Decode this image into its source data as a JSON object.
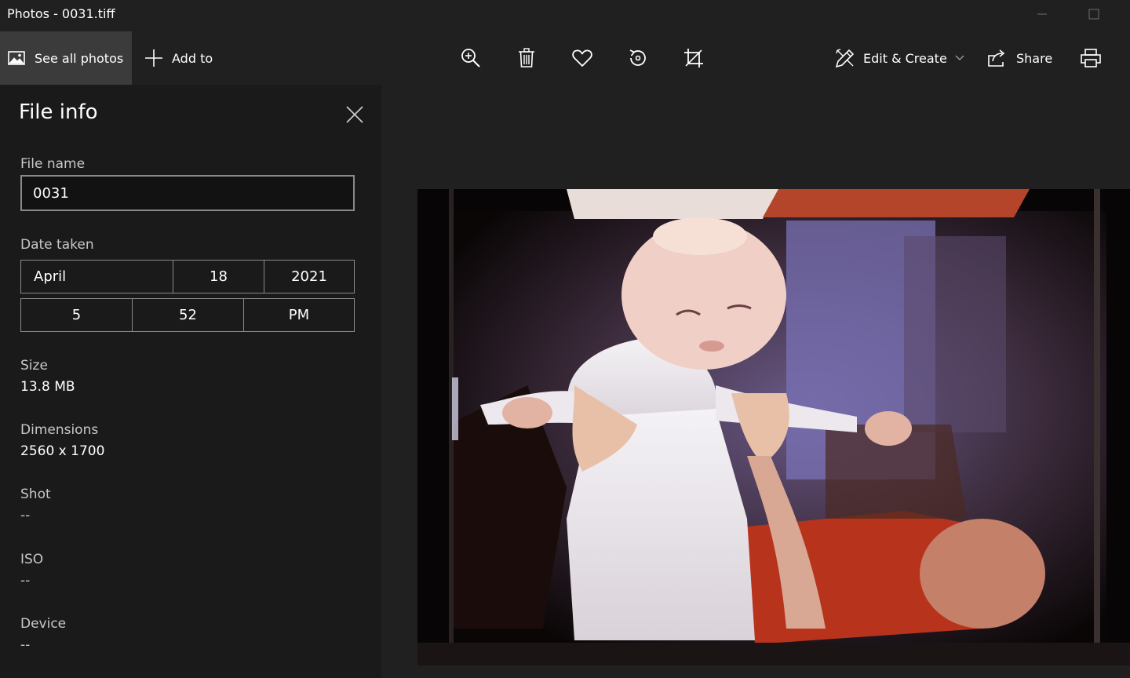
{
  "window": {
    "title": "Photos - 0031.tiff"
  },
  "toolbar": {
    "see_all_photos": "See all photos",
    "add_to": "Add to",
    "edit_create": "Edit & Create",
    "share": "Share",
    "icons": [
      "zoom-in-icon",
      "delete-icon",
      "favorite-icon",
      "rotate-icon",
      "crop-icon",
      "print-icon"
    ]
  },
  "file_info": {
    "title": "File info",
    "file_name_label": "File name",
    "file_name_value": "0031",
    "date_taken_label": "Date taken",
    "date": {
      "month": "April",
      "day": "18",
      "year": "2021"
    },
    "time": {
      "hour": "5",
      "minute": "52",
      "period": "PM"
    },
    "size_label": "Size",
    "size_value": "13.8 MB",
    "dimensions_label": "Dimensions",
    "dimensions_value": "2560 x 1700",
    "shot_label": "Shot",
    "shot_value": "--",
    "iso_label": "ISO",
    "iso_value": "--",
    "device_label": "Device",
    "device_value": "--"
  },
  "colors": {
    "background": "#202020",
    "panel": "#1a1a1a",
    "selected": "#3b3b3b"
  }
}
